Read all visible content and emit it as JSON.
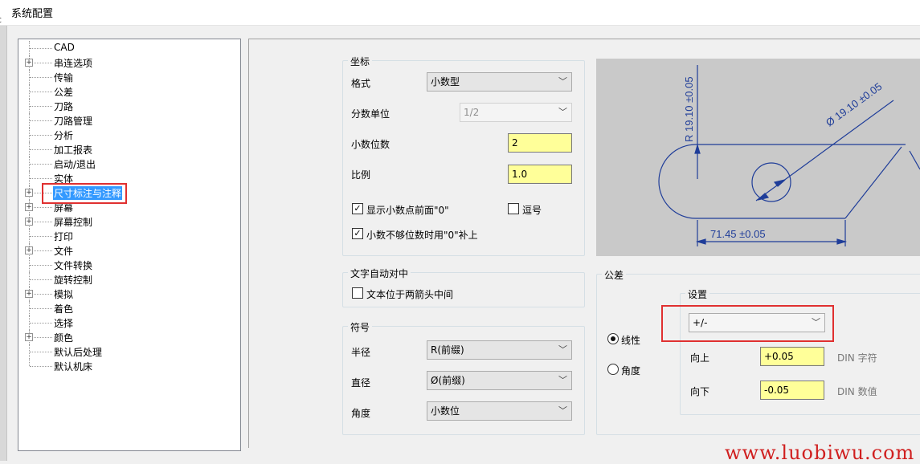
{
  "window": {
    "title": "系统配置",
    "edge_char": "c"
  },
  "tree": {
    "items": [
      {
        "label": "CAD",
        "expandable": false
      },
      {
        "label": "串连选项",
        "expandable": true
      },
      {
        "label": "传输",
        "expandable": false
      },
      {
        "label": "公差",
        "expandable": false
      },
      {
        "label": "刀路",
        "expandable": false
      },
      {
        "label": "刀路管理",
        "expandable": false
      },
      {
        "label": "分析",
        "expandable": false
      },
      {
        "label": "加工报表",
        "expandable": false
      },
      {
        "label": "启动/退出",
        "expandable": false
      },
      {
        "label": "实体",
        "expandable": false
      },
      {
        "label": "尺寸标注与注释",
        "expandable": true,
        "selected": true
      },
      {
        "label": "屏幕",
        "expandable": true
      },
      {
        "label": "屏幕控制",
        "expandable": true
      },
      {
        "label": "打印",
        "expandable": false
      },
      {
        "label": "文件",
        "expandable": true
      },
      {
        "label": "文件转换",
        "expandable": false
      },
      {
        "label": "旋转控制",
        "expandable": false
      },
      {
        "label": "模拟",
        "expandable": true
      },
      {
        "label": "着色",
        "expandable": false
      },
      {
        "label": "选择",
        "expandable": false
      },
      {
        "label": "颜色",
        "expandable": true
      },
      {
        "label": "默认后处理",
        "expandable": false
      },
      {
        "label": "默认机床",
        "expandable": false
      }
    ]
  },
  "coords": {
    "title": "坐标",
    "format_label": "格式",
    "format_value": "小数型",
    "fraction_label": "分数单位",
    "fraction_value": "1/2",
    "decimals_label": "小数位数",
    "decimals_value": "2",
    "scale_label": "比例",
    "scale_value": "1.0",
    "show_leading_zero_label": "显示小数点前面\"0\"",
    "show_leading_zero_checked": true,
    "comma_label": "逗号",
    "comma_checked": false,
    "pad_zero_label": "小数不够位数时用\"0\"补上",
    "pad_zero_checked": true
  },
  "text_center": {
    "title": "文字自动对中",
    "between_arrows_label": "文本位于两箭头中间",
    "checked": false
  },
  "symbols": {
    "title": "符号",
    "radius_label": "半径",
    "radius_value": "R(前缀)",
    "diameter_label": "直径",
    "diameter_value": "Ø(前缀)",
    "angle_label": "角度",
    "angle_value": "小数位"
  },
  "preview": {
    "radius_dim": "R 19.10 ±0.05",
    "diameter_dim": "Ø 19.10 ±0.05",
    "linear_dim": "71.45 ±0.05"
  },
  "tolerance": {
    "title": "公差",
    "linear_label": "线性",
    "linear_selected": true,
    "angle_label": "角度",
    "angle_selected": false,
    "settings_title": "设置",
    "mode_value": "+/-",
    "upper_label": "向上",
    "upper_value": "+0.05",
    "din_char_label": "DIN 字符",
    "lower_label": "向下",
    "lower_value": "-0.05",
    "din_value_label": "DIN 数值"
  },
  "watermark": "www.luobiwu.com"
}
